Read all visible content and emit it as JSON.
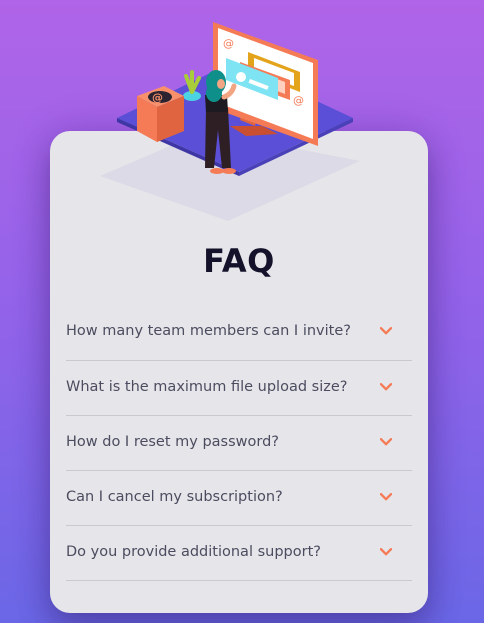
{
  "app": {
    "title": "FAQ"
  },
  "faq": {
    "items": [
      {
        "question": "How many team members can I invite?",
        "icon": "chevron-down-icon"
      },
      {
        "question": "What is the maximum file upload size?",
        "icon": "chevron-down-icon"
      },
      {
        "question": "How do I reset my password?",
        "icon": "chevron-down-icon"
      },
      {
        "question": "Can I cancel my subscription?",
        "icon": "chevron-down-icon"
      },
      {
        "question": "Do you provide additional support?",
        "icon": "chevron-down-icon"
      }
    ]
  },
  "illustration": {
    "icon": "woman-online-illustration",
    "box_glyph": "@",
    "screen_glyph_top": "@",
    "screen_glyph_bottom": "@"
  },
  "colors": {
    "background_top": "#b064e8",
    "background_bottom": "#6a67e6",
    "card": "#e6e6ea",
    "title": "#14112a",
    "question_text": "#4b4c5f",
    "accent_chevron": "#f47b56",
    "divider": "#c9c9cf"
  }
}
